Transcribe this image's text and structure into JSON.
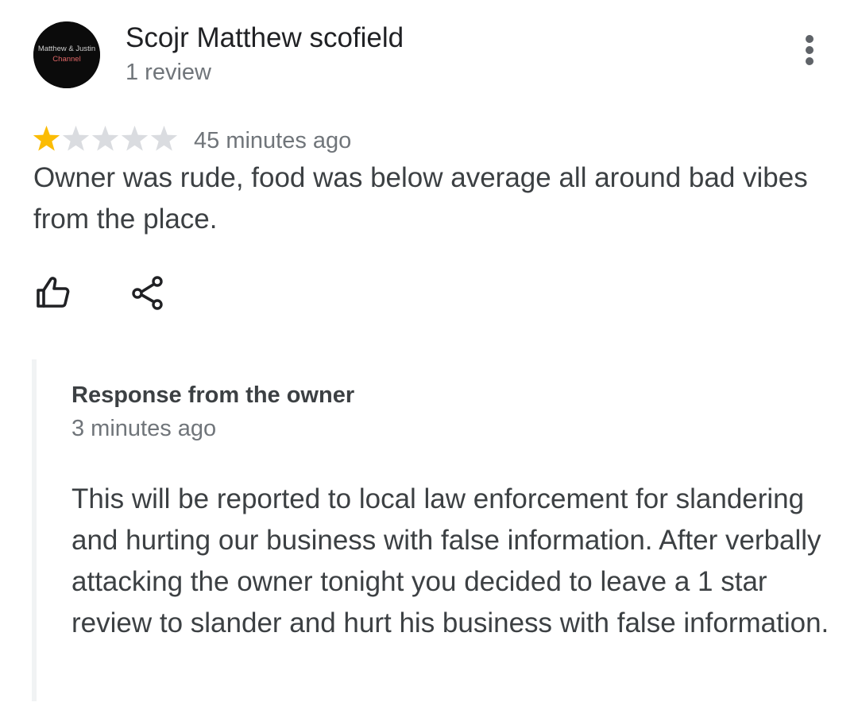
{
  "review": {
    "reviewer_name": "Scojr Matthew scofield",
    "review_count": "1 review",
    "avatar_text_line1": "Matthew & Justin",
    "avatar_text_line2": "Channel",
    "rating": 1,
    "rating_max": 5,
    "time": "45 minutes ago",
    "text": "Owner was rude, food was below average all around bad vibes from the place.",
    "icons": {
      "more": "more-vert-icon",
      "like": "thumbs-up-icon",
      "share": "share-icon",
      "star_filled": "star-filled-icon",
      "star_empty": "star-empty-icon"
    }
  },
  "owner_response": {
    "title": "Response from the owner",
    "time": "3 minutes ago",
    "text": "This will be reported to local law enforcement for slandering and hurting our business with false information. After verbally attacking the owner tonight you decided to leave a 1 star review to slander and hurt his business with false information."
  },
  "colors": {
    "star_filled": "#fbbc04",
    "star_empty": "#dadce0",
    "secondary_text": "#70757a",
    "avatar_bg": "#0b0b0b"
  }
}
